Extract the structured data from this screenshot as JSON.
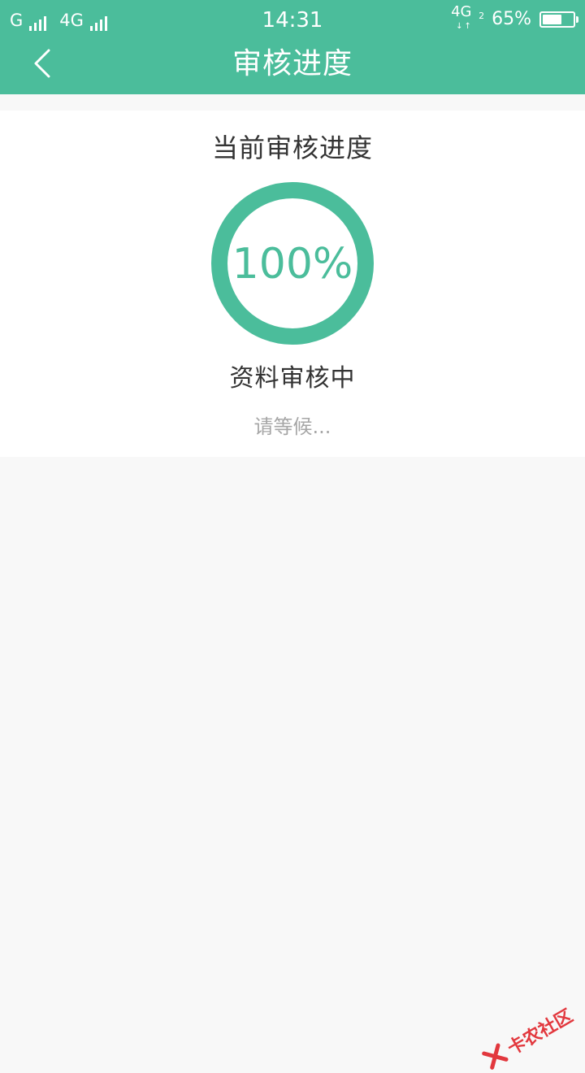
{
  "status_bar": {
    "sim1": "G",
    "sim2": "4G",
    "time": "14:31",
    "network": "4G",
    "network_sub": "2",
    "battery": "65%",
    "battery_level": 0.65
  },
  "header": {
    "title": "审核进度"
  },
  "progress_card": {
    "heading": "当前审核进度",
    "percent_text": "100%",
    "percent_value": 1.0,
    "status": "资料审核中",
    "hint": "请等候..."
  },
  "watermark": {
    "text": "卡农社区"
  },
  "colors": {
    "accent": "#4bbd9b",
    "background": "#f8f8f8",
    "card": "#ffffff",
    "watermark": "#e0242a"
  },
  "icons": {
    "back": "chevron-left-icon",
    "signal": "signal-bars-icon",
    "battery": "battery-icon"
  }
}
